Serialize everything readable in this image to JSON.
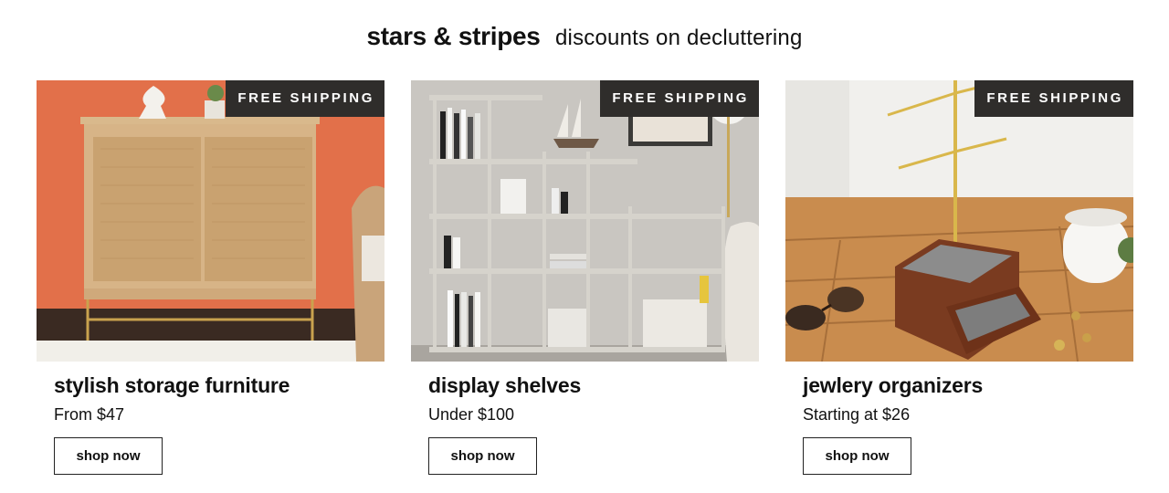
{
  "header": {
    "brand": "stars & stripes",
    "tagline": "discounts on decluttering"
  },
  "cards": [
    {
      "badge": "FREE SHIPPING",
      "title": "stylish storage furniture",
      "price": "From $47",
      "button": "shop now",
      "image": "rattan-cabinet-photo"
    },
    {
      "badge": "FREE SHIPPING",
      "title": "display shelves",
      "price": "Under $100",
      "button": "shop now",
      "image": "bookshelf-photo"
    },
    {
      "badge": "FREE SHIPPING",
      "title": "jewlery organizers",
      "price": "Starting at $26",
      "button": "shop now",
      "image": "jewelry-stand-photo"
    }
  ],
  "colors": {
    "badge_bg": "#2f2d2b",
    "text": "#111111",
    "button_border": "#222222"
  }
}
